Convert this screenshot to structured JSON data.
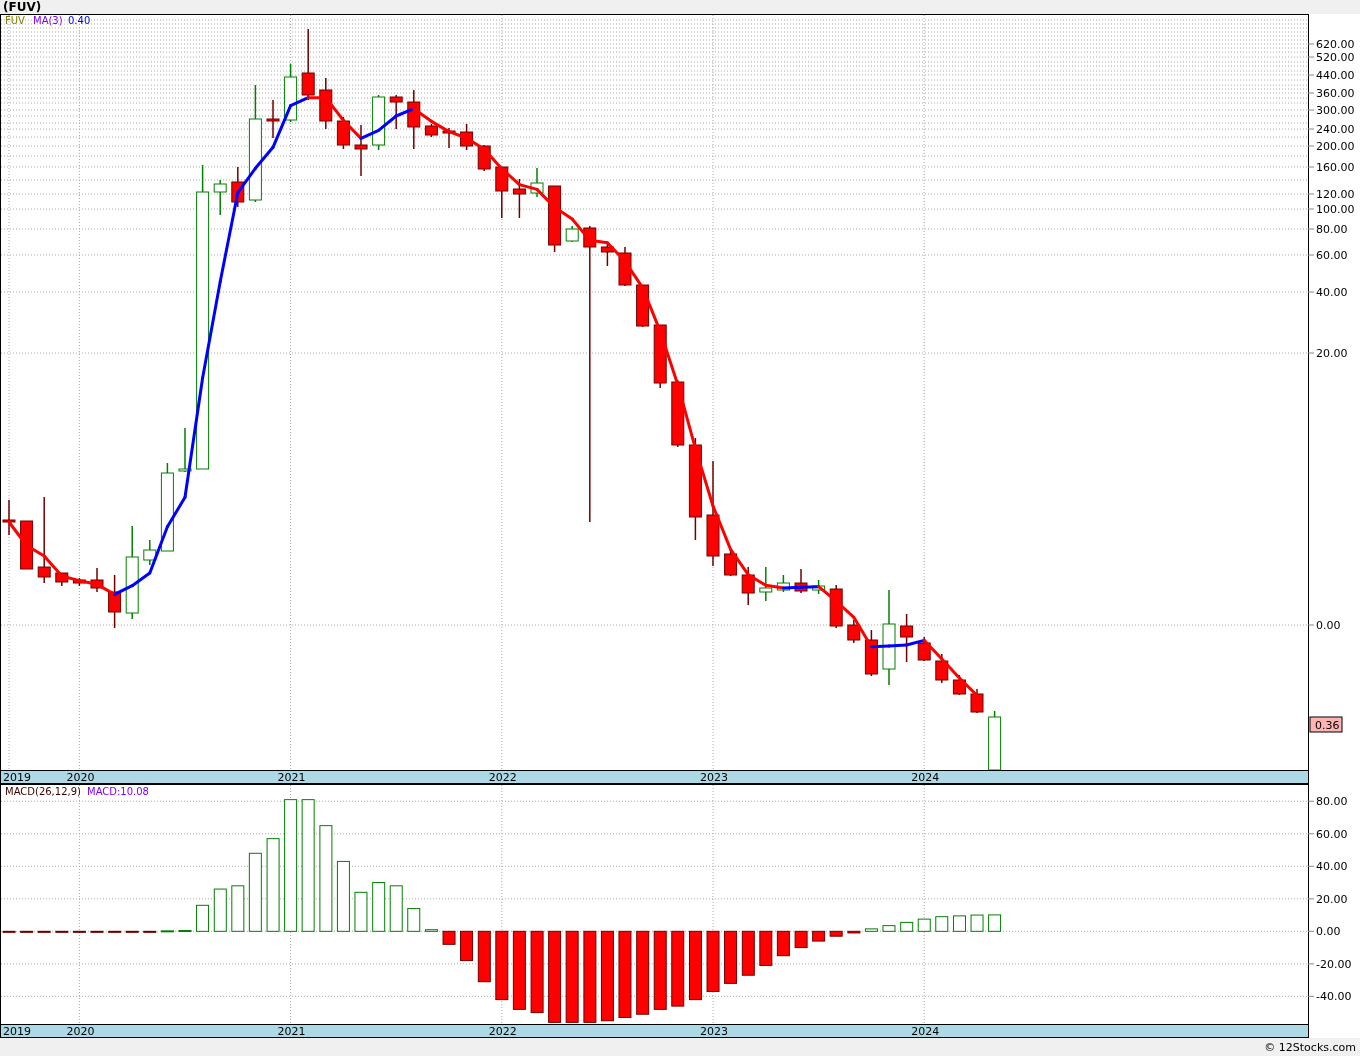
{
  "title": "(FUV)",
  "price_panel": {
    "legend": [
      {
        "text": "FUV",
        "color": "#808000"
      },
      {
        "text": "MA(3)",
        "color": "#8000ff"
      },
      {
        "text": "0.40",
        "color": "#0000ff"
      }
    ],
    "y_labels": [
      "620.00",
      "520.00",
      "440.00",
      "360.00",
      "300.00",
      "240.00",
      "200.00",
      "160.00",
      "120.00",
      "100.00",
      "80.00",
      "60.00",
      "40.00",
      "20.00",
      "0.00"
    ],
    "last_price": "0.36",
    "x_labels": [
      "2019",
      "2020",
      "2021",
      "2022",
      "2023",
      "2024"
    ]
  },
  "macd_panel": {
    "legend": [
      {
        "text": "MACD:10.08",
        "color": "#8000ff"
      }
    ],
    "x_start_label": "2019",
    "chart_data": {
      "type": "bar",
      "x": [
        2019.667,
        2019.75,
        2019.833,
        2019.917,
        2020,
        2020.083,
        2020.167,
        2020.25,
        2020.333,
        2020.417,
        2020.5,
        2020.583,
        2020.667,
        2020.75,
        2020.833,
        2020.917,
        2021,
        2021.083,
        2021.167,
        2021.25,
        2021.333,
        2021.417,
        2021.5,
        2021.583,
        2021.667,
        2021.75,
        2021.833,
        2021.917,
        2022,
        2022.083,
        2022.167,
        2022.25,
        2022.333,
        2022.417,
        2022.5,
        2022.583,
        2022.667,
        2022.75,
        2022.833,
        2022.917,
        2023,
        2023.083,
        2023.167,
        2023.25,
        2023.333,
        2023.417,
        2023.5,
        2023.583,
        2023.667,
        2023.75,
        2023.833,
        2023.917,
        2024,
        2024.083,
        2024.167,
        2024.25,
        2024.333
      ],
      "series": [
        {
          "name": "MACD(26,12,9)",
          "values": [
            -0.2,
            -0.2,
            -0.2,
            -0.2,
            -0.2,
            -0.2,
            -0.2,
            -0.2,
            -0.3,
            0.3,
            0.5,
            16,
            26,
            28,
            48,
            57,
            81,
            81,
            65,
            43,
            24,
            30,
            28,
            14,
            1,
            -8,
            -18,
            -31,
            -42,
            -48,
            -50,
            -56,
            -56,
            -56,
            -55,
            -53,
            -51,
            -48,
            -46,
            -42,
            -37,
            -32,
            -27,
            -21,
            -15,
            -10,
            -6,
            -3,
            -1,
            1.5,
            3.5,
            5.5,
            7.5,
            9,
            9.5,
            10,
            10.1
          ]
        }
      ],
      "ylim": [
        -57,
        90
      ],
      "yticks": [
        {
          "value": 80,
          "label": "80.00"
        },
        {
          "value": 60,
          "label": "60.00"
        },
        {
          "value": 40,
          "label": "40.00"
        },
        {
          "value": 20,
          "label": "20.00"
        },
        {
          "value": 0,
          "label": "0.00"
        },
        {
          "value": -20,
          "label": "-20.00"
        },
        {
          "value": -40,
          "label": "-40.00"
        }
      ],
      "xlim": [
        2019.624,
        2025.817
      ],
      "grid": true,
      "xticks": [
        2020,
        2021,
        2022,
        2023,
        2024
      ]
    }
  },
  "credit": "© 12Stocks.com"
}
